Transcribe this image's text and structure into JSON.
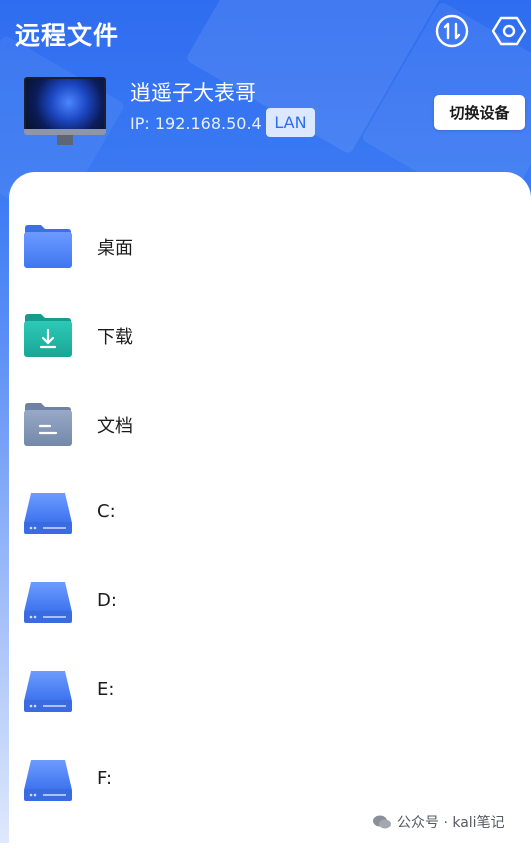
{
  "header": {
    "title": "远程文件",
    "icons": {
      "transfer": "transfer-icon",
      "settings": "settings-hex-icon"
    }
  },
  "device": {
    "name": "逍遥子大表哥",
    "ip": "IP: 192.168.50.4",
    "badge": "LAN",
    "switch_label": "切换设备"
  },
  "folders": [
    {
      "name": "桌面",
      "icon": "desktop-folder-icon"
    },
    {
      "name": "下载",
      "icon": "download-folder-icon"
    },
    {
      "name": "文档",
      "icon": "documents-folder-icon"
    },
    {
      "name": "C:",
      "icon": "drive-icon"
    },
    {
      "name": "D:",
      "icon": "drive-icon"
    },
    {
      "name": "E:",
      "icon": "drive-icon"
    },
    {
      "name": "F:",
      "icon": "drive-icon"
    }
  ],
  "watermark": "公众号 · kali笔记",
  "colors": {
    "primary": "#2f6df0",
    "folder_blue": "#4c83f5",
    "folder_teal": "#21b3a3",
    "folder_gray": "#8396b5"
  }
}
